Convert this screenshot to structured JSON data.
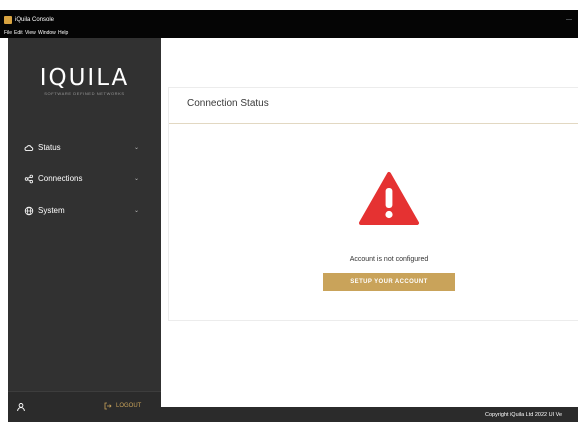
{
  "window": {
    "title": "iQuila Console",
    "minimize": "—"
  },
  "menu": [
    "File",
    "Edit",
    "View",
    "Window",
    "Help"
  ],
  "sidebar": {
    "logo": "IQUILA",
    "tagline": "SOFTWARE DEFINED NETWORKS",
    "items": [
      {
        "label": "Status",
        "icon": "cloud-icon"
      },
      {
        "label": "Connections",
        "icon": "share-icon"
      },
      {
        "label": "System",
        "icon": "globe-icon"
      }
    ],
    "chevron": "⌄",
    "logout": "LOGOUT"
  },
  "main": {
    "card_title": "Connection Status",
    "message": "Account is not configured",
    "setup_button": "SETUP YOUR ACCOUNT"
  },
  "status_bar": {
    "copyright": "Copyright iQuila Ltd 2022 UI Ve"
  },
  "colors": {
    "sidebar_bg": "#313131",
    "accent_gold": "#c9a35a",
    "warning_red": "#e53232",
    "titlebar_bg": "#050505"
  }
}
